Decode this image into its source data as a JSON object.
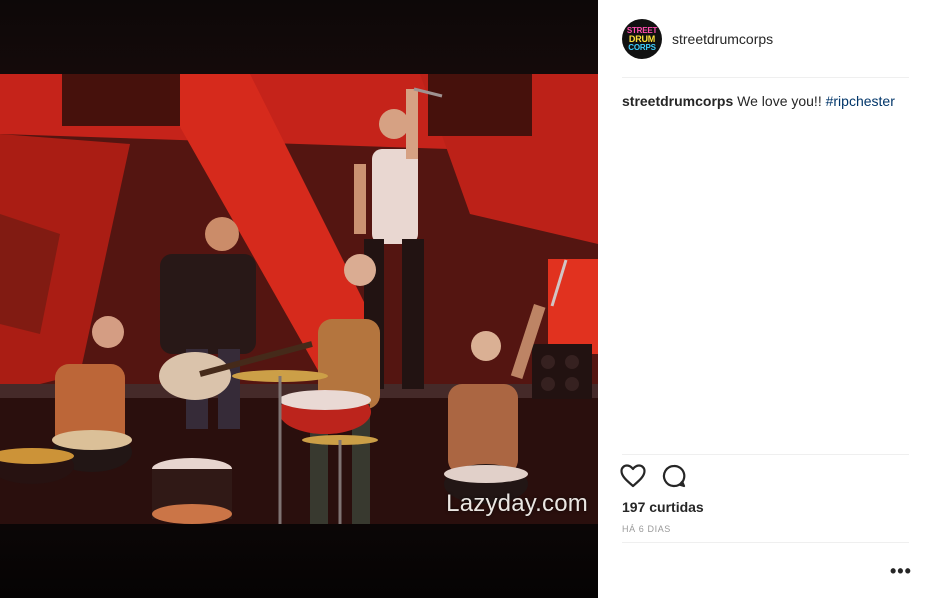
{
  "post": {
    "username": "streetdrumcorps",
    "avatar": {
      "line1": "STREET",
      "line2": "DRUM",
      "line3": "CORPS"
    },
    "image": {
      "watermark": "Lazyday.com"
    },
    "caption": {
      "username": "streetdrumcorps",
      "text": " We love you!! ",
      "hashtag": "#ripchester"
    },
    "likes_label": "197 curtidas",
    "time_label": "HÁ 6 DIAS",
    "more_label": "•••",
    "icons": {
      "like": "heart-icon",
      "comment": "comment-icon",
      "more": "more-options-icon"
    },
    "colors": {
      "link": "#003569",
      "text": "#262626",
      "muted": "#999999",
      "divider": "#efefef"
    }
  }
}
